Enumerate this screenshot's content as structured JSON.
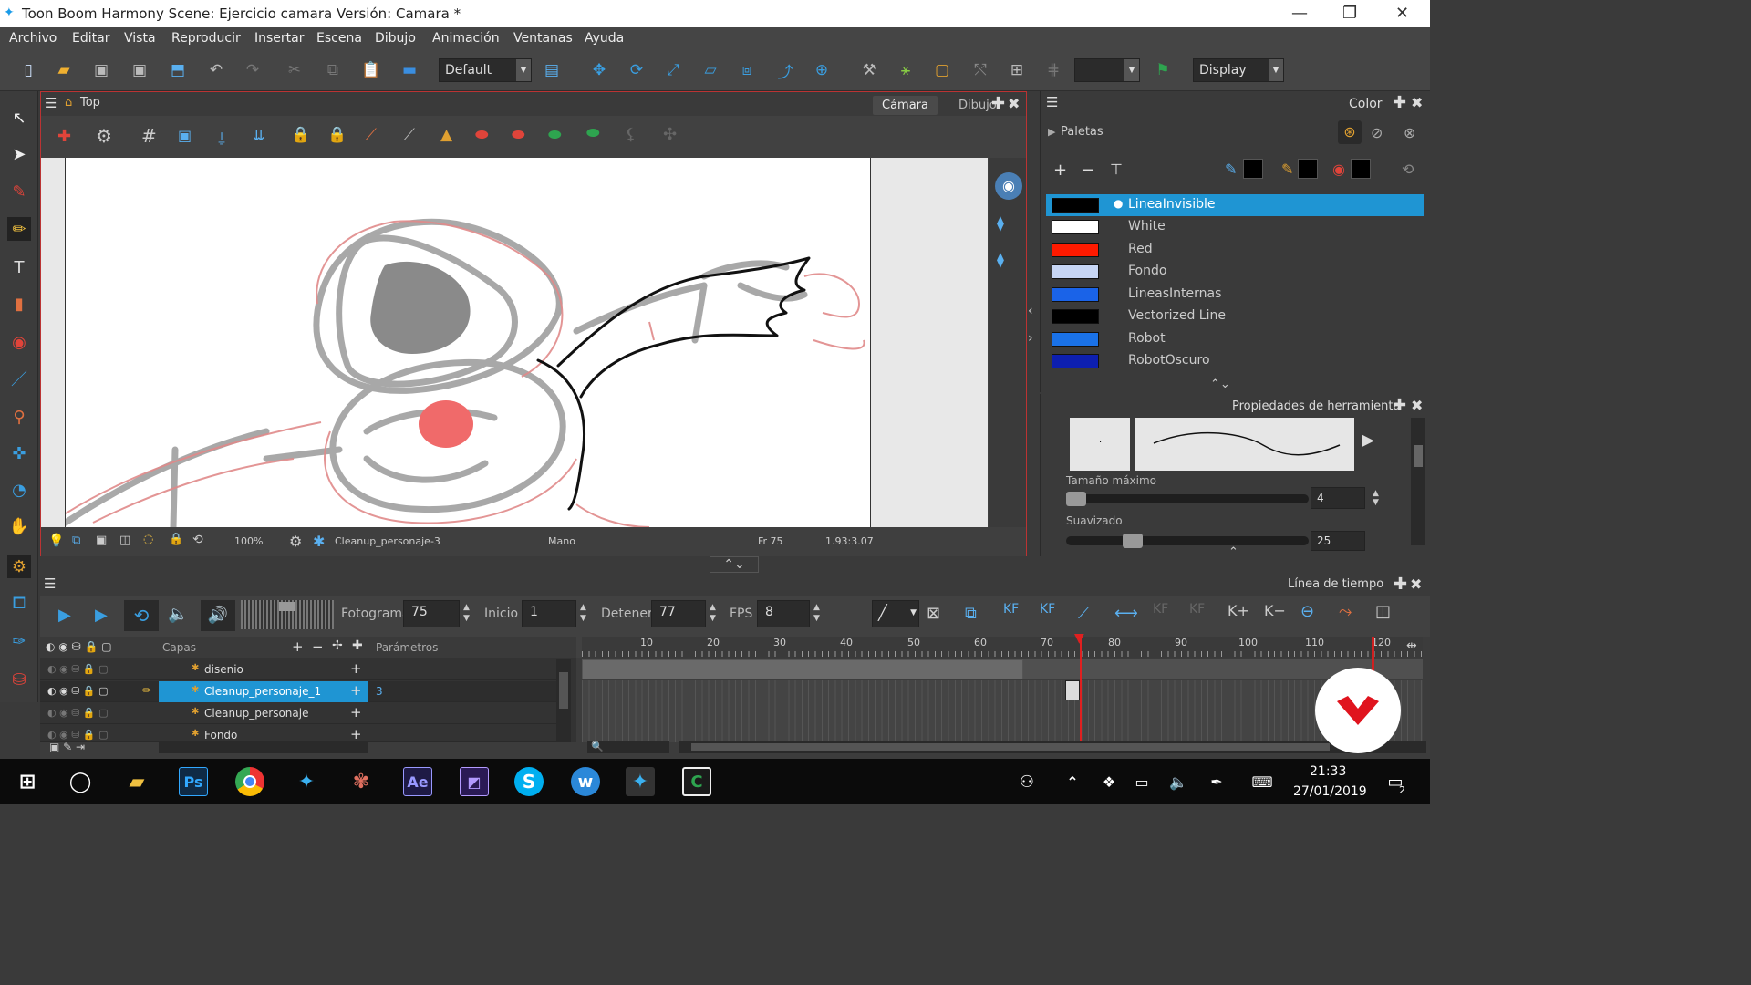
{
  "window": {
    "title": "Toon Boom Harmony Scene: Ejercicio camara Versión: Camara *"
  },
  "menu": [
    "Archivo",
    "Editar",
    "Vista",
    "Reproducir",
    "Insertar",
    "Escena",
    "Dibujo",
    "Animación",
    "Ventanas",
    "Ayuda"
  ],
  "toolbar": {
    "workspace": "Default",
    "display": "Display"
  },
  "view": {
    "title": "Top",
    "tab_camera": "Cámara",
    "tab_drawing": "Dibujo",
    "zoom": "100%",
    "layer": "Cleanup_personaje-3",
    "tool": "Mano",
    "frame": "Fr 75",
    "coords": "1.93:3.07"
  },
  "color_panel": {
    "title": "Color",
    "palettes_label": "Paletas",
    "swatches": [
      {
        "name": "LineaInvisible",
        "color": "#000000",
        "selected": true
      },
      {
        "name": "White",
        "color": "#ffffff"
      },
      {
        "name": "Red",
        "color": "#ff1a00"
      },
      {
        "name": "Fondo",
        "color": "#c7d6f5"
      },
      {
        "name": "LineasInternas",
        "color": "#1a63e8"
      },
      {
        "name": "Vectorized Line",
        "color": "#000000"
      },
      {
        "name": "Robot",
        "color": "#1a72e8"
      },
      {
        "name": "RobotOscuro",
        "color": "#0d1fb0"
      }
    ]
  },
  "tool_properties": {
    "title": "Propiedades de herramienta",
    "max_size_label": "Tamaño máximo",
    "max_size": "4",
    "max_size_level": 0.05,
    "smoothing_label": "Suavizado",
    "smoothing": "25",
    "smoothing_level": 0.25
  },
  "timeline": {
    "title": "Línea de tiempo",
    "frame_label": "Fotograma",
    "frame": "75",
    "start_label": "Inicio",
    "start": "1",
    "stop_label": "Detener",
    "stop": "77",
    "fps_label": "FPS",
    "fps": "8",
    "layers_header": "Capas",
    "params_header": "Parámetros",
    "ruler": [
      "10",
      "20",
      "30",
      "40",
      "50",
      "60",
      "70",
      "80",
      "90",
      "100",
      "110",
      "120"
    ],
    "playhead_frame": 75,
    "layers": [
      {
        "name": "disenio",
        "param": ""
      },
      {
        "name": "Cleanup_personaje_1",
        "param": "3",
        "selected": true
      },
      {
        "name": "Cleanup_personaje",
        "param": ""
      },
      {
        "name": "Fondo",
        "param": ""
      }
    ]
  },
  "taskbar": {
    "time": "21:33",
    "date": "27/01/2019",
    "notifications": "2"
  }
}
